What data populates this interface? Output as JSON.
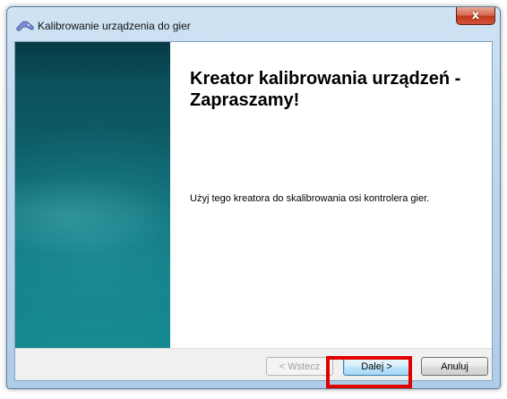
{
  "window": {
    "title": "Kalibrowanie urządzenia do gier",
    "close_glyph": "x",
    "icon": "game-controller-icon"
  },
  "wizard": {
    "heading": "Kreator kalibrowania urządzeń - Zapraszamy!",
    "description": "Użyj tego kreatora do skalibrowania osi kontrolera gier."
  },
  "buttons": {
    "back_label": "< Wstecz",
    "next_label": "Dalej >",
    "cancel_label": "Anuluj"
  },
  "colors": {
    "side_panel": "#0d5d68",
    "highlight": "#e00000"
  }
}
